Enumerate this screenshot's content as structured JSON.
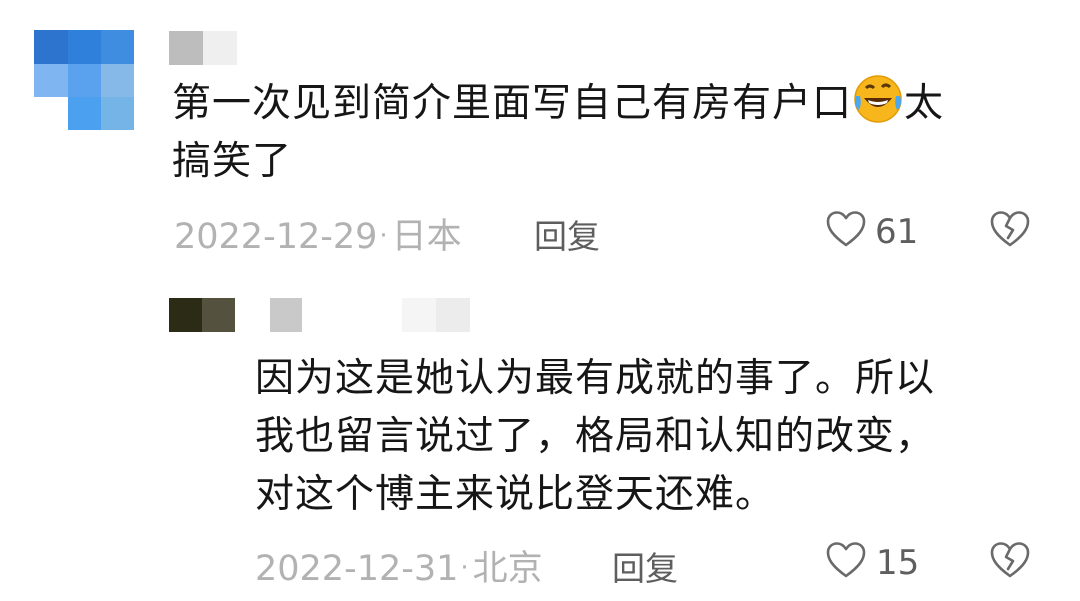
{
  "comments": [
    {
      "text_before_emoji": "第一次见到简介里面写自己有房有户口",
      "emoji": "rolling-on-floor-laughing-emoji",
      "text_after_emoji": "太\n搞笑了",
      "date": "2022-12-29",
      "location": "日本",
      "reply_label": "回复",
      "likes": "61"
    },
    {
      "text": "因为这是她认为最有成就的事了。所以\n我也留言说过了，格局和认知的改变，\n对这个博主来说比登天还难。",
      "date": "2022-12-31",
      "location": "北京",
      "reply_label": "回复",
      "likes": "15"
    }
  ],
  "meta_separator": "·",
  "colors": {
    "text": "#161616",
    "meta": "#b2b2b2",
    "action": "#5e5e5e"
  }
}
